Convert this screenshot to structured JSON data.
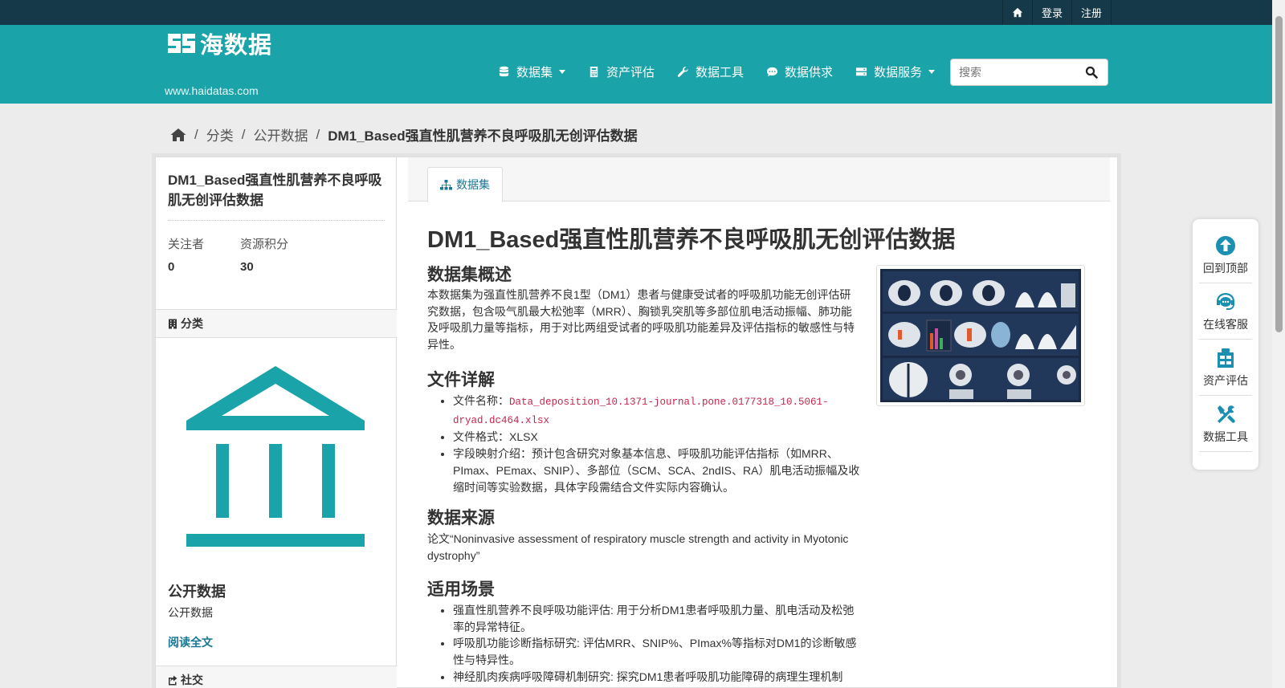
{
  "topbar": {
    "home_icon": "home-icon",
    "login": "登录",
    "register": "注册"
  },
  "header": {
    "logo_text": "海数据",
    "logo_url": "www.haidatas.com",
    "nav": [
      {
        "label": "数据集",
        "icon": "database-icon",
        "dropdown": true
      },
      {
        "label": "资产评估",
        "icon": "calculator-icon",
        "dropdown": false
      },
      {
        "label": "数据工具",
        "icon": "wrench-icon",
        "dropdown": false
      },
      {
        "label": "数据供求",
        "icon": "chat-icon",
        "dropdown": false
      },
      {
        "label": "数据服务",
        "icon": "server-icon",
        "dropdown": true
      }
    ],
    "search_placeholder": "搜索"
  },
  "breadcrumb": {
    "home_icon": "home-icon",
    "items": [
      "分类",
      "公开数据"
    ],
    "current": "DM1_Based强直性肌营养不良呼吸肌无创评估数据"
  },
  "sidebar": {
    "title": "DM1_Based强直性肌营养不良呼吸肌无创评估数据",
    "followers_label": "关注者",
    "followers_value": "0",
    "points_label": "资源积分",
    "points_value": "30",
    "category_heading": "分类",
    "category_icon": "building-icon",
    "org_name": "公开数据",
    "org_desc": "公开数据",
    "read_more": "阅读全文",
    "social_heading": "社交"
  },
  "main": {
    "tab_label": "数据集",
    "tab_icon": "sitemap-icon",
    "title": "DM1_Based强直性肌营养不良呼吸肌无创评估数据",
    "overview_heading": "数据集概述",
    "overview_text": "本数据集为强直性肌营养不良1型（DM1）患者与健康受试者的呼吸肌功能无创评估研究数据，包含吸气肌最大松弛率（MRR）、胸锁乳突肌等多部位肌电活动振幅、肺功能及呼吸肌力量等指标，用于对比两组受试者的呼吸肌功能差异及评估指标的敏感性与特异性。",
    "file_heading": "文件详解",
    "file_name_label": "文件名称：",
    "file_name_value": "Data_deposition_10.1371-journal.pone.0177318_10.5061-dryad.dc464.xlsx",
    "file_format": "文件格式：XLSX",
    "field_mapping": "字段映射介绍：预计包含研究对象基本信息、呼吸肌功能评估指标（如MRR、PImax、PEmax、SNIP）、多部位（SCM、SCA、2ndIS、RA）肌电活动振幅及收缩时间等实验数据，具体字段需结合文件实际内容确认。",
    "source_heading": "数据来源",
    "source_text": "论文“Noninvasive assessment of respiratory muscle strength and activity in Myotonic dystrophy”",
    "usage_heading": "适用场景",
    "usage_items": [
      "强直性肌营养不良呼吸功能评估: 用于分析DM1患者呼吸肌力量、肌电活动及松弛率的异常特征。",
      "呼吸肌功能诊断指标研究: 评估MRR、SNIP%、PImax%等指标对DM1的诊断敏感性与特异性。",
      "神经肌肉疾病呼吸障碍机制研究: 探究DM1患者呼吸肌功能障碍的病理生理机制"
    ]
  },
  "float_tools": [
    {
      "label": "回到顶部",
      "icon": "arrow-up-circle-icon"
    },
    {
      "label": "在线客服",
      "icon": "headset-icon"
    },
    {
      "label": "资产评估",
      "icon": "clipboard-icon"
    },
    {
      "label": "数据工具",
      "icon": "tools-icon"
    }
  ],
  "colors": {
    "topbar": "#16394a",
    "header": "#1aa3a8",
    "accent": "#187794"
  }
}
